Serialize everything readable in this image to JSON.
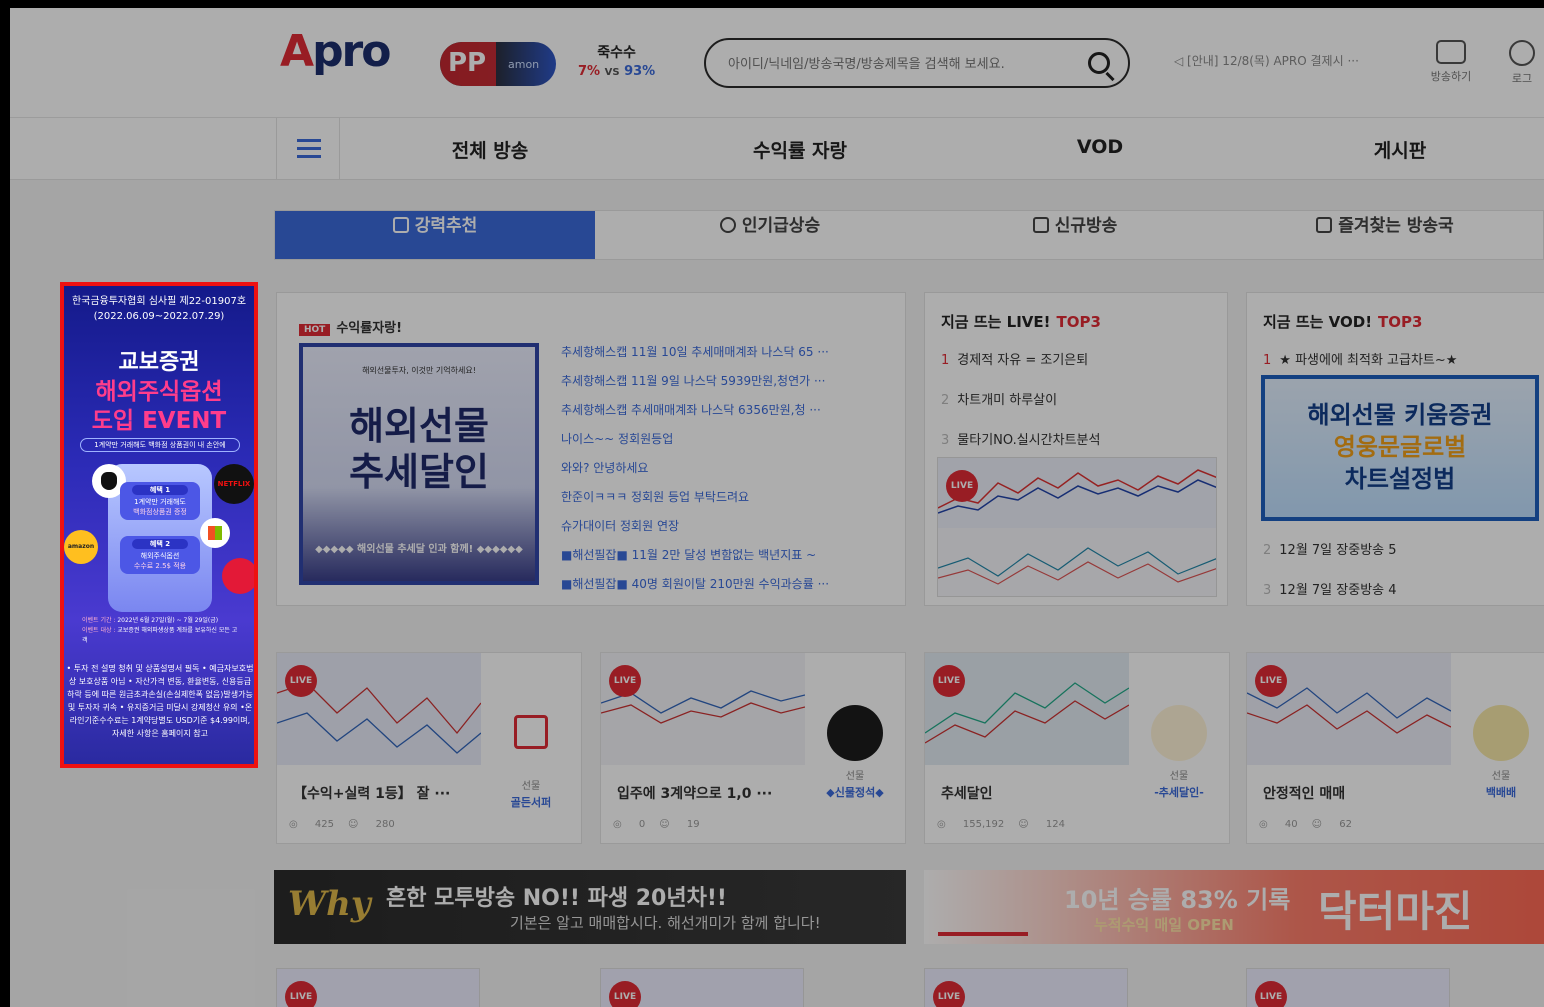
{
  "header": {
    "logo": "pro",
    "logo_accent": "A",
    "pp_badge": "PP",
    "pp_badge_sub": "amon",
    "vote_question": "죽수수",
    "vote_left": "7%",
    "vote_vs": "VS",
    "vote_right": "93%",
    "search_placeholder": "아이디/닉네임/방송국명/방송제목을 검색해 보세요.",
    "notice": "[안내] 12/8(목) APRO 결제시 ···",
    "broadcast_label": "방송하기",
    "login_label": "로그"
  },
  "nav": {
    "items": [
      "전체 방송",
      "수익률 자랑",
      "VOD",
      "게시판"
    ]
  },
  "tabs": [
    "강력추천",
    "인기급상승",
    "신규방송",
    "즐겨찾는 방송국"
  ],
  "ad": {
    "top_line1": "한국금융투자협회 심사필 제22-01907호",
    "top_line2": "(2022.06.09~2022.07.29)",
    "brand": "교보증권",
    "headline1": "해외주식옵션",
    "headline2": "도입 EVENT",
    "pill": "1계약만 거래해도 백화점 상품권이 내 손안에",
    "card1_title": "혜택 1",
    "card1_text": "1계약만 거래해도",
    "card1_pink": "백화점상품권 증정",
    "card2_title": "혜택 2",
    "card2_text": "해외주식옵션",
    "card2_pink": "수수료 2.5$ 적용",
    "period_label": "이벤트 기간 :",
    "period_value": "2022년 6월 27일(월) ~ 7월 29일(금)",
    "target_label": "이벤트 대상 :",
    "target_value": "교보증권 해외파생상품 계좌를 보유하신 모든 고객",
    "footer": "• 투자 전 설명 청취 및 상품설명서 필독 • 예금자보호법상 보호상품 아님 • 자산가격 변동, 환율변동, 신용등급 하락 등에 따른 원금초과손실(손실제한폭 없음)발생가능 및 투자자 귀속 • 유지증거금 미달시 강제청산 유의 •온라인기준수수료는 1계약당별도 USD기준 $4.99이며, 자세한 사항은 홈페이지 참고",
    "netflix": "NETFLIX",
    "amazon": "amazon"
  },
  "hot_panel": {
    "badge": "HOT",
    "title": "수익률자랑!",
    "image_small": "해외선물투자, 이것만 기억하세요!",
    "image_line1": "해외선물",
    "image_line2": "추세달인",
    "image_caption": "◆◆◆◆◆ 해외선물 추세달 인과 함께! ◆◆◆◆◆◆",
    "items": [
      "추세항해스캡 11월 10일 추세매매계좌 나스닥 65 ···",
      "추세항해스캡 11월 9일 나스닥 5939만원,청연가 ···",
      "추세항해스캡 추세매매계좌 나스닥 6356만원,청 ···",
      "나이스~~ 정회원등업",
      "와와? 안녕하세요",
      "한준이ㅋㅋㅋ 정회원 등업 부탁드려요",
      "슈가대이터 정회원 연장",
      "■해선필잡■ 11월 2만 달성 변함없는 백년지표 ~",
      "■해선필잡■ 40명 회원이탈 210만원 수익과승률 ···"
    ]
  },
  "live_top3": {
    "title": "지금 뜨는 LIVE!",
    "accent": "TOP3",
    "ranks": [
      {
        "num": "1",
        "text": "경제적 자유 = 조기은퇴"
      },
      {
        "num": "2",
        "text": "차트개미 하루살이"
      },
      {
        "num": "3",
        "text": "물타기NO.실시간차트분석"
      }
    ],
    "live_badge": "LIVE"
  },
  "vod_top3": {
    "title": "지금 뜨는 VOD!",
    "accent": "TOP3",
    "first": "★ 파생에에 최적화 고급차트~★",
    "first_num": "1",
    "banner_line1": "해외선물 키움증권",
    "banner_line2": "영웅문글로벌",
    "banner_line3": "차트설정법",
    "ranks": [
      {
        "num": "2",
        "text": "12월 7일 장중방송 5"
      },
      {
        "num": "3",
        "text": "12월 7일 장중방송 4"
      }
    ]
  },
  "cards": [
    {
      "title": "【수익+실력 1등】 잘 ···",
      "views": "425",
      "viewers": "280",
      "label": "선물",
      "name": "골든서퍼"
    },
    {
      "title": "입주에 3계약으로 1,0 ···",
      "views": "0",
      "viewers": "19",
      "label": "선물",
      "name": "◆신물정석◆"
    },
    {
      "title": "추세달인",
      "views": "155,192",
      "viewers": "124",
      "label": "선물",
      "name": "-추세달인-"
    },
    {
      "title": "안정적인 매매",
      "views": "40",
      "viewers": "62",
      "label": "선물",
      "name": "백배배"
    }
  ],
  "banners": {
    "left_why": "Why",
    "left_main": "흔한 모투방송 NO!! 파생 20년차!!",
    "left_sub": "기본은 알고 매매합시다. 해선개미가 함께 합니다!",
    "right_main": "10년 승률 83% 기록",
    "right_sub": "누적수익 매일 OPEN",
    "right_brand": "닥터마진"
  },
  "colors": {
    "accent": "#3c6bdb",
    "hot": "#e12c35",
    "ad_border": "#ee1111"
  }
}
